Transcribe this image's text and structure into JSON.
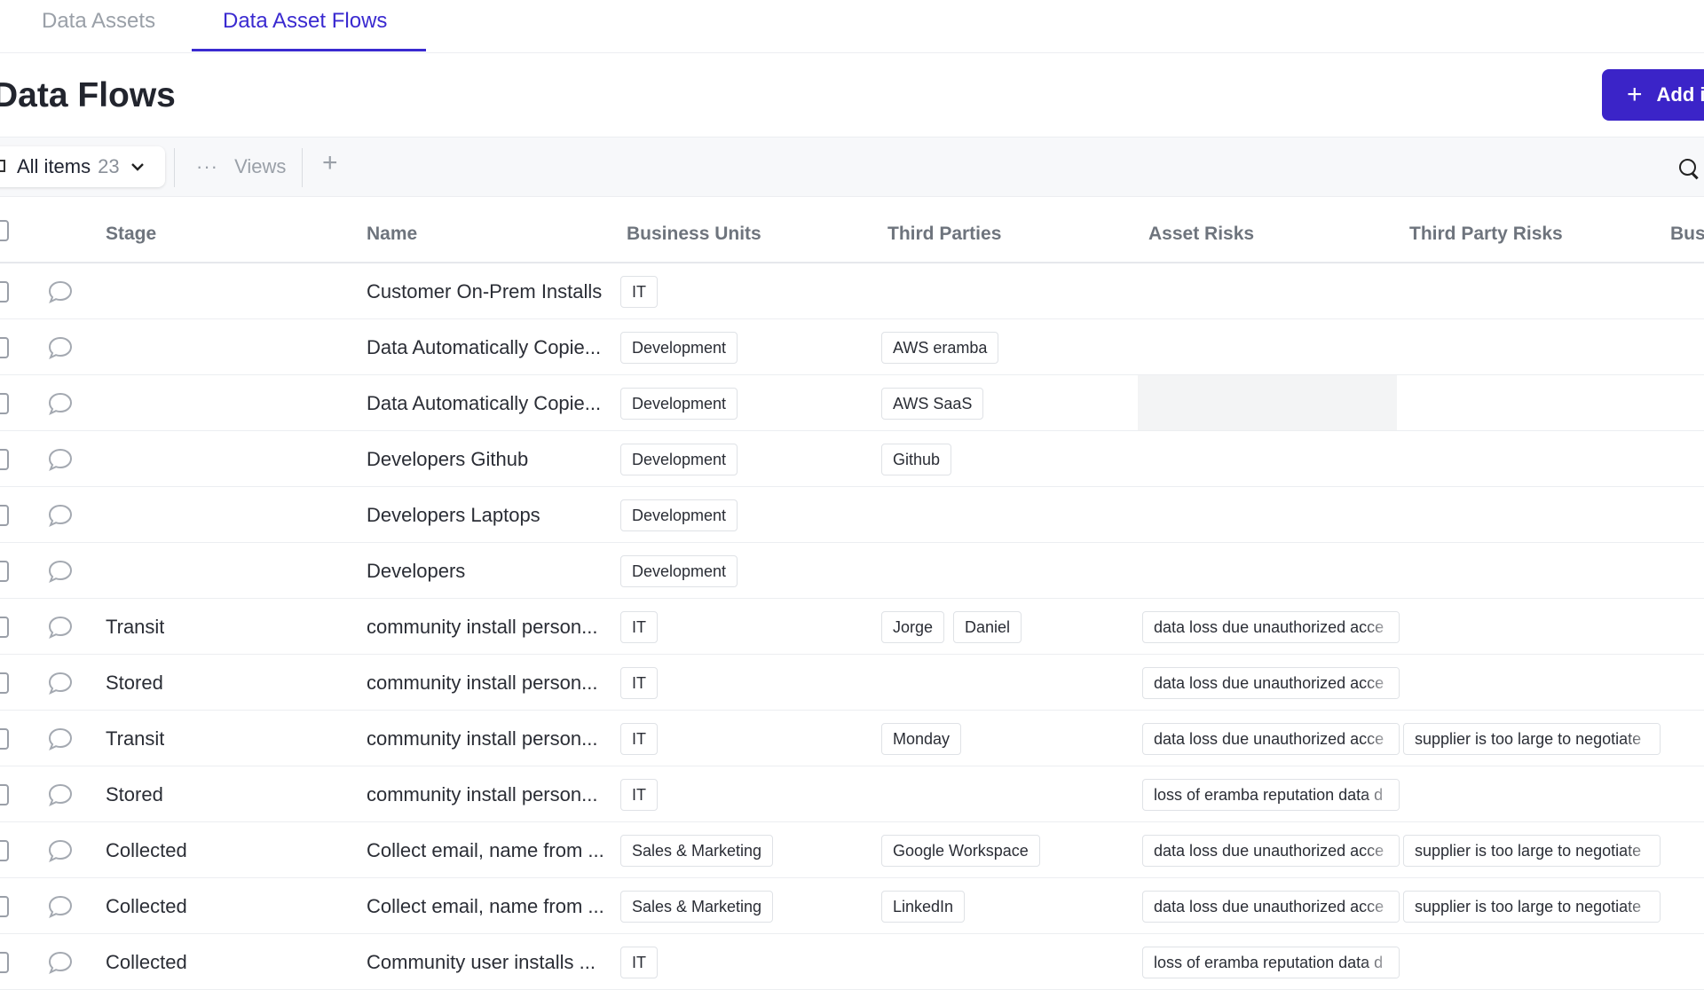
{
  "tabs": [
    {
      "label": "Data Assets",
      "active": false
    },
    {
      "label": "Data Asset Flows",
      "active": true
    }
  ],
  "page_title": "Data Flows",
  "add_button_label": "Add i",
  "toolbar": {
    "all_items_label": "All items",
    "all_items_count": "23",
    "views_label": "Views"
  },
  "columns": [
    "Stage",
    "Name",
    "Business Units",
    "Third Parties",
    "Asset Risks",
    "Third Party Risks",
    "Bus"
  ],
  "rows": [
    {
      "stage": "",
      "name": "Customer On-Prem Installs",
      "units": [
        "IT"
      ],
      "third": [],
      "asset_risk": "",
      "tp_risk": ""
    },
    {
      "stage": "",
      "name": "Data Automatically Copie...",
      "units": [
        "Development"
      ],
      "third": [
        "AWS eramba"
      ],
      "asset_risk": "",
      "tp_risk": ""
    },
    {
      "stage": "",
      "name": "Data Automatically Copie...",
      "units": [
        "Development"
      ],
      "third": [
        "AWS SaaS"
      ],
      "asset_risk": "",
      "tp_risk": "",
      "highlight_asset_cell": true
    },
    {
      "stage": "",
      "name": "Developers Github",
      "units": [
        "Development"
      ],
      "third": [
        "Github"
      ],
      "asset_risk": "",
      "tp_risk": ""
    },
    {
      "stage": "",
      "name": "Developers Laptops",
      "units": [
        "Development"
      ],
      "third": [],
      "asset_risk": "",
      "tp_risk": ""
    },
    {
      "stage": "",
      "name": "Developers",
      "units": [
        "Development"
      ],
      "third": [],
      "asset_risk": "",
      "tp_risk": ""
    },
    {
      "stage": "Transit",
      "name": "community install person...",
      "units": [
        "IT"
      ],
      "third": [
        "Jorge",
        "Daniel"
      ],
      "asset_risk": "data loss due unauthorized acce",
      "tp_risk": ""
    },
    {
      "stage": "Stored",
      "name": "community install person...",
      "units": [
        "IT"
      ],
      "third": [],
      "asset_risk": "data loss due unauthorized acce",
      "tp_risk": ""
    },
    {
      "stage": "Transit",
      "name": "community install person...",
      "units": [
        "IT"
      ],
      "third": [
        "Monday"
      ],
      "asset_risk": "data loss due unauthorized acce",
      "tp_risk": "supplier is too large to negotiate"
    },
    {
      "stage": "Stored",
      "name": "community install person...",
      "units": [
        "IT"
      ],
      "third": [],
      "asset_risk": "loss of eramba reputation data d",
      "tp_risk": ""
    },
    {
      "stage": "Collected",
      "name": "Collect email, name from ...",
      "units": [
        "Sales & Marketing"
      ],
      "third": [
        "Google Workspace"
      ],
      "asset_risk": "data loss due unauthorized acce",
      "tp_risk": "supplier is too large to negotiate"
    },
    {
      "stage": "Collected",
      "name": "Collect email, name from ...",
      "units": [
        "Sales & Marketing"
      ],
      "third": [
        "LinkedIn"
      ],
      "asset_risk": "data loss due unauthorized acce",
      "tp_risk": "supplier is too large to negotiate"
    },
    {
      "stage": "Collected",
      "name": "Community user installs ...",
      "units": [
        "IT"
      ],
      "third": [],
      "asset_risk": "loss of eramba reputation data d",
      "tp_risk": ""
    }
  ],
  "colors": {
    "accent": "#3b24c8",
    "tab_active": "#3a2ad0"
  }
}
